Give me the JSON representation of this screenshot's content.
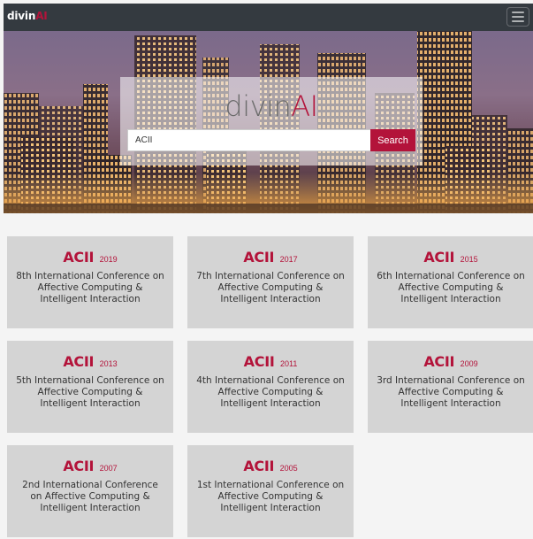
{
  "navbar": {
    "brand_main": "divin",
    "brand_accent": "AI",
    "menu_icon": "hamburger-menu-icon"
  },
  "hero": {
    "logo_main": "divin",
    "logo_accent": "AI",
    "search_value": "ACII",
    "search_button": "Search"
  },
  "colors": {
    "accent": "#b3133a",
    "navbar": "#343a40",
    "card": "#d4d4d4"
  },
  "conferences": [
    {
      "acronym": "ACII",
      "year": "2019",
      "description": "8th International Conference on Affective Computing & Intelligent Interaction"
    },
    {
      "acronym": "ACII",
      "year": "2017",
      "description": "7th International Conference on Affective Computing & Intelligent Interaction"
    },
    {
      "acronym": "ACII",
      "year": "2015",
      "description": "6th International Conference on Affective Computing & Intelligent Interaction"
    },
    {
      "acronym": "ACII",
      "year": "2013",
      "description": "5th International Conference on Affective Computing & Intelligent Interaction"
    },
    {
      "acronym": "ACII",
      "year": "2011",
      "description": "4th International Conference on Affective Computing & Intelligent Interaction"
    },
    {
      "acronym": "ACII",
      "year": "2009",
      "description": "3rd International Conference on Affective Computing & Intelligent Interaction"
    },
    {
      "acronym": "ACII",
      "year": "2007",
      "description": "2nd International Conference on Affective Computing & Intelligent Interaction"
    },
    {
      "acronym": "ACII",
      "year": "2005",
      "description": "1st International Conference on Affective Computing & Intelligent Interaction"
    }
  ]
}
